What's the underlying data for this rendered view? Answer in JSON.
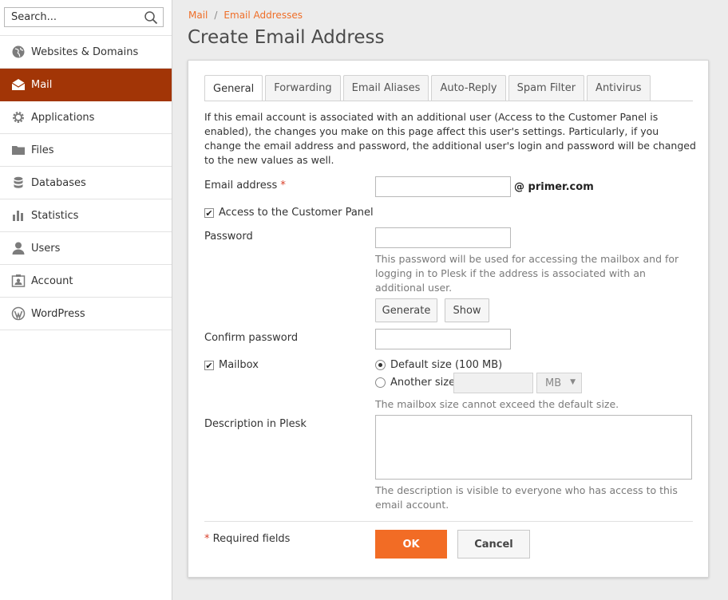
{
  "search": {
    "placeholder": "Search..."
  },
  "sidebar": {
    "items": [
      {
        "label": "Websites & Domains",
        "icon": "globe-icon"
      },
      {
        "label": "Mail",
        "icon": "envelope-icon",
        "active": true
      },
      {
        "label": "Applications",
        "icon": "gear-icon"
      },
      {
        "label": "Files",
        "icon": "folder-icon"
      },
      {
        "label": "Databases",
        "icon": "database-icon"
      },
      {
        "label": "Statistics",
        "icon": "bar-chart-icon"
      },
      {
        "label": "Users",
        "icon": "user-icon"
      },
      {
        "label": "Account",
        "icon": "id-card-icon"
      },
      {
        "label": "WordPress",
        "icon": "wordpress-icon"
      }
    ]
  },
  "breadcrumb": {
    "items": [
      "Mail",
      "Email Addresses"
    ],
    "separator": "/"
  },
  "page": {
    "title": "Create Email Address"
  },
  "tabs": [
    "General",
    "Forwarding",
    "Email Aliases",
    "Auto-Reply",
    "Spam Filter",
    "Antivirus"
  ],
  "form": {
    "intro": "If this email account is associated with an additional user (Access to the Customer Panel is enabled), the changes you make on this page affect this user's settings. Particularly, if you change the email address and password, the additional user's login and password will be changed to the new values as well.",
    "email_label": "Email address",
    "required_mark": "*",
    "email_value": "",
    "domain": "@ primer.com",
    "customer_panel_label": "Access to the Customer Panel",
    "customer_panel_checked": true,
    "password_label": "Password",
    "password_value": "",
    "password_hint": "This password will be used for accessing the mailbox and for logging in to Plesk if the address is associated with an additional user.",
    "generate_label": "Generate",
    "show_label": "Show",
    "confirm_label": "Confirm password",
    "confirm_value": "",
    "mailbox_label": "Mailbox",
    "mailbox_checked": true,
    "default_size_label": "Default size (100 MB)",
    "another_size_label": "Another size",
    "size_unit": "MB",
    "mailbox_hint": "The mailbox size cannot exceed the default size.",
    "description_label": "Description in Plesk",
    "description_value": "",
    "description_hint": "The description is visible to everyone who has access to this email account.",
    "required_fields_label": "Required fields",
    "ok_label": "OK",
    "cancel_label": "Cancel"
  },
  "colors": {
    "accent": "#f26c25",
    "active_nav": "#a23506",
    "link": "#ef6e28"
  }
}
